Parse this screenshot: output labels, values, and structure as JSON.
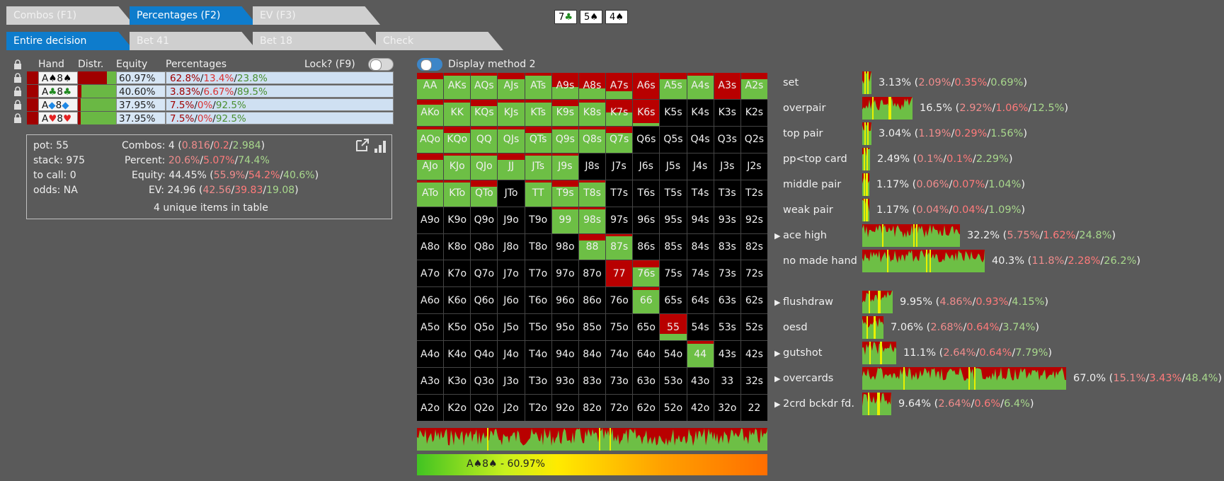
{
  "tabs_top": [
    {
      "label": "Combos (F1)",
      "active": false
    },
    {
      "label": "Percentages (F2)",
      "active": true
    },
    {
      "label": "EV (F3)",
      "active": false
    }
  ],
  "tabs_actions": [
    {
      "label": "Entire decision",
      "active": true
    },
    {
      "label": "Bet 41",
      "active": false
    },
    {
      "label": "Bet 18",
      "active": false
    },
    {
      "label": "Check",
      "active": false
    }
  ],
  "board": [
    {
      "rank": "7",
      "suit": "♣",
      "color": "#1f8a1f"
    },
    {
      "rank": "5",
      "suit": "♠",
      "color": "#000000"
    },
    {
      "rank": "4",
      "suit": "♠",
      "color": "#000000"
    }
  ],
  "hand_table": {
    "headers": {
      "hand": "Hand",
      "distr": "Distr.",
      "equity": "Equity",
      "percentages": "Percentages",
      "lock": "Lock? (F9)"
    },
    "rows": [
      {
        "rank1": "A",
        "suit1": "♠",
        "c1": "#000000",
        "rank2": "8",
        "suit2": "♠",
        "c2": "#000000",
        "equity": "60.97%",
        "a": "62.8%",
        "b": "13.4%",
        "c": "23.8%",
        "red": 0.76
      },
      {
        "rank1": "A",
        "suit1": "♣",
        "c1": "#1f8a1f",
        "rank2": "8",
        "suit2": "♣",
        "c2": "#1f8a1f",
        "equity": "40.60%",
        "a": "3.83%",
        "b": "6.67%",
        "c": "89.5%",
        "red": 0.1
      },
      {
        "rank1": "A",
        "suit1": "◆",
        "c1": "#1e88e5",
        "rank2": "8",
        "suit2": "◆",
        "c2": "#1e88e5",
        "equity": "37.95%",
        "a": "7.5%",
        "b": "0%",
        "c": "92.5%",
        "red": 0.075
      },
      {
        "rank1": "A",
        "suit1": "♥",
        "c1": "#e52222",
        "rank2": "8",
        "suit2": "♥",
        "c2": "#e52222",
        "equity": "37.95%",
        "a": "7.5%",
        "b": "0%",
        "c": "92.5%",
        "red": 0.075
      }
    ]
  },
  "info": {
    "pot": "pot: 55",
    "stack": "stack: 975",
    "tocall": "to call: 0",
    "odds": "odds: NA",
    "combos_label": "Combos:",
    "combos_main": "4 (",
    "combos_a": "0.816",
    "combos_b": "0.2",
    "combos_c": "2.984",
    "percent_label": "Percent:",
    "percent_a": "20.6%",
    "percent_b": "5.07%",
    "percent_c": "74.4%",
    "equity_label": "Equity:",
    "equity_main": "44.45% (",
    "equity_a": "55.9%",
    "equity_b": "54.2%",
    "equity_c": "40.6%",
    "ev_label": "EV:",
    "ev_main": "24.96 (",
    "ev_a": "42.56",
    "ev_b": "39.83",
    "ev_c": "19.08",
    "unique": "4 unique items in table",
    "close_paren": ")",
    "slash": "/"
  },
  "display_method": "Display method 2",
  "matrix": [
    [
      "AA",
      "AKs",
      "AQs",
      "AJs",
      "ATs",
      "A9s",
      "A8s",
      "A7s",
      "A6s",
      "A5s",
      "A4s",
      "A3s",
      "A2s"
    ],
    [
      "AKo",
      "KK",
      "KQs",
      "KJs",
      "KTs",
      "K9s",
      "K8s",
      "K7s",
      "K6s",
      "K5s",
      "K4s",
      "K3s",
      "K2s"
    ],
    [
      "AQo",
      "KQo",
      "QQ",
      "QJs",
      "QTs",
      "Q9s",
      "Q8s",
      "Q7s",
      "Q6s",
      "Q5s",
      "Q4s",
      "Q3s",
      "Q2s"
    ],
    [
      "AJo",
      "KJo",
      "QJo",
      "JJ",
      "JTs",
      "J9s",
      "J8s",
      "J7s",
      "J6s",
      "J5s",
      "J4s",
      "J3s",
      "J2s"
    ],
    [
      "ATo",
      "KTo",
      "QTo",
      "JTo",
      "TT",
      "T9s",
      "T8s",
      "T7s",
      "T6s",
      "T5s",
      "T4s",
      "T3s",
      "T2s"
    ],
    [
      "A9o",
      "K9o",
      "Q9o",
      "J9o",
      "T9o",
      "99",
      "98s",
      "97s",
      "96s",
      "95s",
      "94s",
      "93s",
      "92s"
    ],
    [
      "A8o",
      "K8o",
      "Q8o",
      "J8o",
      "T8o",
      "98o",
      "88",
      "87s",
      "86s",
      "85s",
      "84s",
      "83s",
      "82s"
    ],
    [
      "A7o",
      "K7o",
      "Q7o",
      "J7o",
      "T7o",
      "97o",
      "87o",
      "77",
      "76s",
      "75s",
      "74s",
      "73s",
      "72s"
    ],
    [
      "A6o",
      "K6o",
      "Q6o",
      "J6o",
      "T6o",
      "96o",
      "86o",
      "76o",
      "66",
      "65s",
      "64s",
      "63s",
      "62s"
    ],
    [
      "A5o",
      "K5o",
      "Q5o",
      "J5o",
      "T5o",
      "95o",
      "85o",
      "75o",
      "65o",
      "55",
      "54s",
      "53s",
      "52s"
    ],
    [
      "A4o",
      "K4o",
      "Q4o",
      "J4o",
      "T4o",
      "94o",
      "84o",
      "74o",
      "64o",
      "54o",
      "44",
      "43s",
      "42s"
    ],
    [
      "A3o",
      "K3o",
      "Q3o",
      "J3o",
      "T3o",
      "93o",
      "83o",
      "73o",
      "63o",
      "53o",
      "43o",
      "33",
      "32s"
    ],
    [
      "A2o",
      "K2o",
      "Q2o",
      "J2o",
      "T2o",
      "92o",
      "82o",
      "72o",
      "62o",
      "52o",
      "42o",
      "32o",
      "22"
    ]
  ],
  "gradient_label": "A♠8♠ - 60.97%",
  "categories": [
    {
      "label": "set",
      "expand": false,
      "value": "3.13%",
      "a": "2.09%",
      "b": "0.35%",
      "c": "0.69%"
    },
    {
      "label": "overpair",
      "expand": false,
      "value": "16.5%",
      "a": "2.92%",
      "b": "1.06%",
      "c": "12.5%"
    },
    {
      "label": "top pair",
      "expand": false,
      "value": "3.04%",
      "a": "1.19%",
      "b": "0.29%",
      "c": "1.56%"
    },
    {
      "label": "pp<top card",
      "expand": false,
      "value": "2.49%",
      "a": "0.1%",
      "b": "0.1%",
      "c": "2.29%"
    },
    {
      "label": "middle pair",
      "expand": false,
      "value": "1.17%",
      "a": "0.06%",
      "b": "0.07%",
      "c": "1.04%"
    },
    {
      "label": "weak pair",
      "expand": false,
      "value": "1.17%",
      "a": "0.04%",
      "b": "0.04%",
      "c": "1.09%"
    },
    {
      "label": "ace high",
      "expand": true,
      "value": "32.2%",
      "a": "5.75%",
      "b": "1.62%",
      "c": "24.8%"
    },
    {
      "label": "no made hand",
      "expand": false,
      "value": "40.3%",
      "a": "11.8%",
      "b": "2.28%",
      "c": "26.2%"
    },
    {
      "label": "flushdraw",
      "expand": true,
      "value": "9.95%",
      "a": "4.86%",
      "b": "0.93%",
      "c": "4.15%"
    },
    {
      "label": "oesd",
      "expand": false,
      "value": "7.06%",
      "a": "2.68%",
      "b": "0.64%",
      "c": "3.74%"
    },
    {
      "label": "gutshot",
      "expand": true,
      "value": "11.1%",
      "a": "2.64%",
      "b": "0.64%",
      "c": "7.79%"
    },
    {
      "label": "overcards",
      "expand": true,
      "value": "67.0%",
      "a": "15.1%",
      "b": "3.43%",
      "c": "48.4%"
    },
    {
      "label": "2crd bckdr fd.",
      "expand": true,
      "value": "9.64%",
      "a": "2.64%",
      "b": "0.6%",
      "c": "6.4%"
    }
  ],
  "colors": {
    "accent": "#0e7ccc",
    "green": "#6dbf45",
    "red": "#b80000",
    "bg": "#5a5a5a"
  }
}
